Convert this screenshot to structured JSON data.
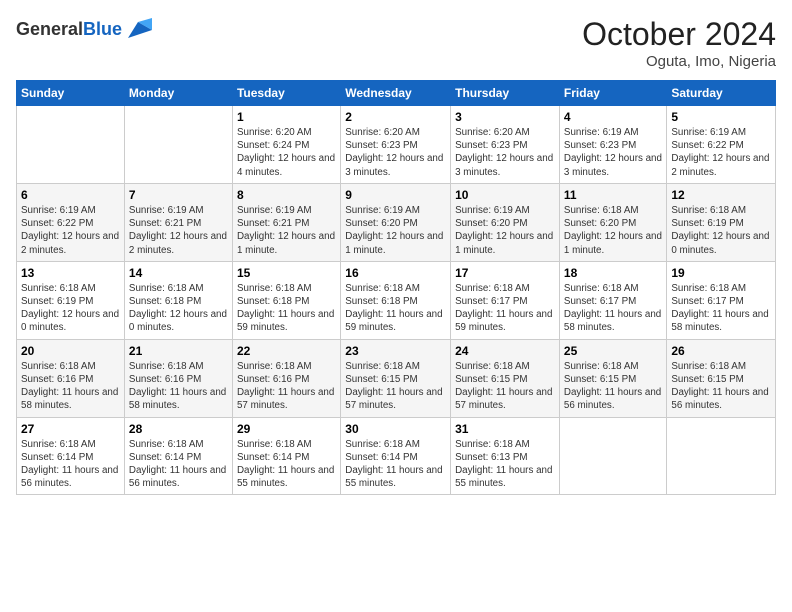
{
  "logo": {
    "general": "General",
    "blue": "Blue"
  },
  "header": {
    "month": "October 2024",
    "location": "Oguta, Imo, Nigeria"
  },
  "weekdays": [
    "Sunday",
    "Monday",
    "Tuesday",
    "Wednesday",
    "Thursday",
    "Friday",
    "Saturday"
  ],
  "weeks": [
    [
      {
        "day": "",
        "sunrise": "",
        "sunset": "",
        "daylight": ""
      },
      {
        "day": "",
        "sunrise": "",
        "sunset": "",
        "daylight": ""
      },
      {
        "day": "1",
        "sunrise": "Sunrise: 6:20 AM",
        "sunset": "Sunset: 6:24 PM",
        "daylight": "Daylight: 12 hours and 4 minutes."
      },
      {
        "day": "2",
        "sunrise": "Sunrise: 6:20 AM",
        "sunset": "Sunset: 6:23 PM",
        "daylight": "Daylight: 12 hours and 3 minutes."
      },
      {
        "day": "3",
        "sunrise": "Sunrise: 6:20 AM",
        "sunset": "Sunset: 6:23 PM",
        "daylight": "Daylight: 12 hours and 3 minutes."
      },
      {
        "day": "4",
        "sunrise": "Sunrise: 6:19 AM",
        "sunset": "Sunset: 6:23 PM",
        "daylight": "Daylight: 12 hours and 3 minutes."
      },
      {
        "day": "5",
        "sunrise": "Sunrise: 6:19 AM",
        "sunset": "Sunset: 6:22 PM",
        "daylight": "Daylight: 12 hours and 2 minutes."
      }
    ],
    [
      {
        "day": "6",
        "sunrise": "Sunrise: 6:19 AM",
        "sunset": "Sunset: 6:22 PM",
        "daylight": "Daylight: 12 hours and 2 minutes."
      },
      {
        "day": "7",
        "sunrise": "Sunrise: 6:19 AM",
        "sunset": "Sunset: 6:21 PM",
        "daylight": "Daylight: 12 hours and 2 minutes."
      },
      {
        "day": "8",
        "sunrise": "Sunrise: 6:19 AM",
        "sunset": "Sunset: 6:21 PM",
        "daylight": "Daylight: 12 hours and 1 minute."
      },
      {
        "day": "9",
        "sunrise": "Sunrise: 6:19 AM",
        "sunset": "Sunset: 6:20 PM",
        "daylight": "Daylight: 12 hours and 1 minute."
      },
      {
        "day": "10",
        "sunrise": "Sunrise: 6:19 AM",
        "sunset": "Sunset: 6:20 PM",
        "daylight": "Daylight: 12 hours and 1 minute."
      },
      {
        "day": "11",
        "sunrise": "Sunrise: 6:18 AM",
        "sunset": "Sunset: 6:20 PM",
        "daylight": "Daylight: 12 hours and 1 minute."
      },
      {
        "day": "12",
        "sunrise": "Sunrise: 6:18 AM",
        "sunset": "Sunset: 6:19 PM",
        "daylight": "Daylight: 12 hours and 0 minutes."
      }
    ],
    [
      {
        "day": "13",
        "sunrise": "Sunrise: 6:18 AM",
        "sunset": "Sunset: 6:19 PM",
        "daylight": "Daylight: 12 hours and 0 minutes."
      },
      {
        "day": "14",
        "sunrise": "Sunrise: 6:18 AM",
        "sunset": "Sunset: 6:18 PM",
        "daylight": "Daylight: 12 hours and 0 minutes."
      },
      {
        "day": "15",
        "sunrise": "Sunrise: 6:18 AM",
        "sunset": "Sunset: 6:18 PM",
        "daylight": "Daylight: 11 hours and 59 minutes."
      },
      {
        "day": "16",
        "sunrise": "Sunrise: 6:18 AM",
        "sunset": "Sunset: 6:18 PM",
        "daylight": "Daylight: 11 hours and 59 minutes."
      },
      {
        "day": "17",
        "sunrise": "Sunrise: 6:18 AM",
        "sunset": "Sunset: 6:17 PM",
        "daylight": "Daylight: 11 hours and 59 minutes."
      },
      {
        "day": "18",
        "sunrise": "Sunrise: 6:18 AM",
        "sunset": "Sunset: 6:17 PM",
        "daylight": "Daylight: 11 hours and 58 minutes."
      },
      {
        "day": "19",
        "sunrise": "Sunrise: 6:18 AM",
        "sunset": "Sunset: 6:17 PM",
        "daylight": "Daylight: 11 hours and 58 minutes."
      }
    ],
    [
      {
        "day": "20",
        "sunrise": "Sunrise: 6:18 AM",
        "sunset": "Sunset: 6:16 PM",
        "daylight": "Daylight: 11 hours and 58 minutes."
      },
      {
        "day": "21",
        "sunrise": "Sunrise: 6:18 AM",
        "sunset": "Sunset: 6:16 PM",
        "daylight": "Daylight: 11 hours and 58 minutes."
      },
      {
        "day": "22",
        "sunrise": "Sunrise: 6:18 AM",
        "sunset": "Sunset: 6:16 PM",
        "daylight": "Daylight: 11 hours and 57 minutes."
      },
      {
        "day": "23",
        "sunrise": "Sunrise: 6:18 AM",
        "sunset": "Sunset: 6:15 PM",
        "daylight": "Daylight: 11 hours and 57 minutes."
      },
      {
        "day": "24",
        "sunrise": "Sunrise: 6:18 AM",
        "sunset": "Sunset: 6:15 PM",
        "daylight": "Daylight: 11 hours and 57 minutes."
      },
      {
        "day": "25",
        "sunrise": "Sunrise: 6:18 AM",
        "sunset": "Sunset: 6:15 PM",
        "daylight": "Daylight: 11 hours and 56 minutes."
      },
      {
        "day": "26",
        "sunrise": "Sunrise: 6:18 AM",
        "sunset": "Sunset: 6:15 PM",
        "daylight": "Daylight: 11 hours and 56 minutes."
      }
    ],
    [
      {
        "day": "27",
        "sunrise": "Sunrise: 6:18 AM",
        "sunset": "Sunset: 6:14 PM",
        "daylight": "Daylight: 11 hours and 56 minutes."
      },
      {
        "day": "28",
        "sunrise": "Sunrise: 6:18 AM",
        "sunset": "Sunset: 6:14 PM",
        "daylight": "Daylight: 11 hours and 56 minutes."
      },
      {
        "day": "29",
        "sunrise": "Sunrise: 6:18 AM",
        "sunset": "Sunset: 6:14 PM",
        "daylight": "Daylight: 11 hours and 55 minutes."
      },
      {
        "day": "30",
        "sunrise": "Sunrise: 6:18 AM",
        "sunset": "Sunset: 6:14 PM",
        "daylight": "Daylight: 11 hours and 55 minutes."
      },
      {
        "day": "31",
        "sunrise": "Sunrise: 6:18 AM",
        "sunset": "Sunset: 6:13 PM",
        "daylight": "Daylight: 11 hours and 55 minutes."
      },
      {
        "day": "",
        "sunrise": "",
        "sunset": "",
        "daylight": ""
      },
      {
        "day": "",
        "sunrise": "",
        "sunset": "",
        "daylight": ""
      }
    ]
  ]
}
